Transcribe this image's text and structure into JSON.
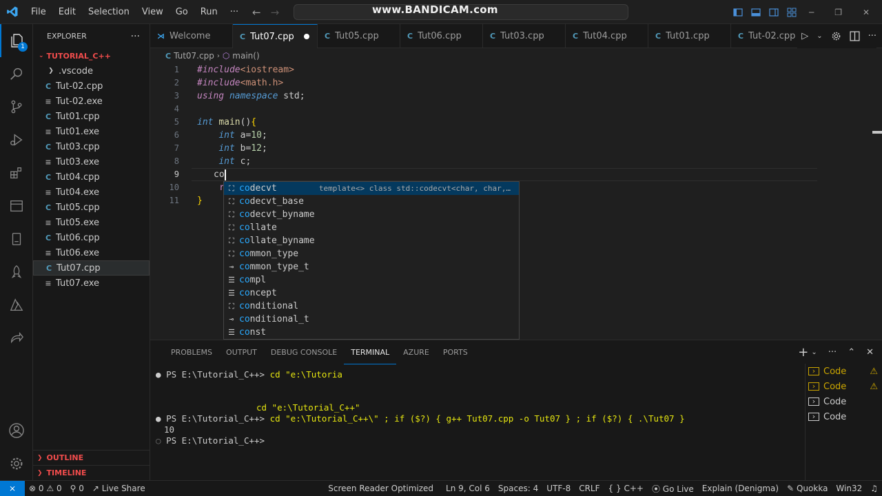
{
  "window": {
    "watermark": "www.BANDICAM.com"
  },
  "menu": [
    "File",
    "Edit",
    "Selection",
    "View",
    "Go",
    "Run",
    "···"
  ],
  "sidebar": {
    "title": "EXPLORER",
    "more": "···",
    "folder": "TUTORIAL_C++",
    "items": [
      {
        "label": ".vscode",
        "type": "dir"
      },
      {
        "label": "Tut-02.cpp",
        "type": "cpp"
      },
      {
        "label": "Tut-02.exe",
        "type": "exe"
      },
      {
        "label": "Tut01.cpp",
        "type": "cpp"
      },
      {
        "label": "Tut01.exe",
        "type": "exe"
      },
      {
        "label": "Tut03.cpp",
        "type": "cpp"
      },
      {
        "label": "Tut03.exe",
        "type": "exe"
      },
      {
        "label": "Tut04.cpp",
        "type": "cpp"
      },
      {
        "label": "Tut04.exe",
        "type": "exe"
      },
      {
        "label": "Tut05.cpp",
        "type": "cpp"
      },
      {
        "label": "Tut05.exe",
        "type": "exe"
      },
      {
        "label": "Tut06.cpp",
        "type": "cpp"
      },
      {
        "label": "Tut06.exe",
        "type": "exe"
      },
      {
        "label": "Tut07.cpp",
        "type": "cpp",
        "selected": true
      },
      {
        "label": "Tut07.exe",
        "type": "exe"
      }
    ],
    "outline": "OUTLINE",
    "timeline": "TIMELINE",
    "badge": "1"
  },
  "tabs": [
    {
      "label": "Welcome",
      "icon": "vscode"
    },
    {
      "label": "Tut07.cpp",
      "icon": "cpp",
      "active": true,
      "modified": true
    },
    {
      "label": "Tut05.cpp",
      "icon": "cpp"
    },
    {
      "label": "Tut06.cpp",
      "icon": "cpp"
    },
    {
      "label": "Tut03.cpp",
      "icon": "cpp"
    },
    {
      "label": "Tut04.cpp",
      "icon": "cpp"
    },
    {
      "label": "Tut01.cpp",
      "icon": "cpp"
    },
    {
      "label": "Tut-02.cpp",
      "icon": "cpp"
    }
  ],
  "breadcrumb": {
    "file": "Tut07.cpp",
    "symbol": "main()"
  },
  "editor": {
    "line_numbers": [
      "1",
      "2",
      "3",
      "4",
      "5",
      "6",
      "7",
      "8",
      "9",
      "10",
      "11"
    ],
    "current_line": 9,
    "cursor_text": "co",
    "hidden_line10_prefix": "r",
    "closing_brace": "}"
  },
  "suggest": {
    "typed": "co",
    "items": [
      {
        "label": "codecvt",
        "kind": "class",
        "detail": "template<> class std::codecvt<char, char,…"
      },
      {
        "label": "codecvt_base",
        "kind": "class"
      },
      {
        "label": "codecvt_byname",
        "kind": "class"
      },
      {
        "label": "collate",
        "kind": "class"
      },
      {
        "label": "collate_byname",
        "kind": "class"
      },
      {
        "label": "common_type",
        "kind": "class"
      },
      {
        "label": "common_type_t",
        "kind": "typedef"
      },
      {
        "label": "compl",
        "kind": "keyword"
      },
      {
        "label": "concept",
        "kind": "keyword"
      },
      {
        "label": "conditional",
        "kind": "class"
      },
      {
        "label": "conditional_t",
        "kind": "typedef"
      },
      {
        "label": "const",
        "kind": "keyword"
      }
    ]
  },
  "panel": {
    "tabs": [
      "PROBLEMS",
      "OUTPUT",
      "DEBUG CONSOLE",
      "TERMINAL",
      "AZURE",
      "PORTS"
    ],
    "active_tab": "TERMINAL",
    "terminal": {
      "line1_prompt": "PS E:\\Tutorial_C++> ",
      "line1_cmd": "cd \"e:\\Tutoria",
      "line2": "cd \"e:\\Tutorial_C++\"",
      "line3_prompt": "PS E:\\Tutorial_C++> ",
      "line3_cmd": "cd \"e:\\Tutorial_C++\\\" ; if ($?) { g++ Tut07.cpp -o Tut07 } ; if ($?) { .\\Tut07 }",
      "line4": "10",
      "line5_prompt": "PS E:\\Tutorial_C++> "
    },
    "term_list": [
      {
        "label": "Code",
        "warn": true
      },
      {
        "label": "Code",
        "warn": true
      },
      {
        "label": "Code",
        "warn": false
      },
      {
        "label": "Code",
        "warn": false
      }
    ]
  },
  "statusbar": {
    "remote": "⨯",
    "errors": "0",
    "warnings": "0",
    "ports": "0",
    "live_share": "Live Share",
    "screen_reader": "Screen Reader Optimized",
    "position": "Ln 9, Col 6",
    "spaces": "Spaces: 4",
    "encoding": "UTF-8",
    "eol": "CRLF",
    "language": "C++",
    "language_icon": "{ }",
    "go_live": "Go Live",
    "explain": "Explain (Denigma)",
    "quokka": "Quokka",
    "platform": "Win32"
  },
  "colors": {
    "accent": "#0078d4",
    "folder_red": "#f14c4c",
    "cpp_icon": "#519aba",
    "warning": "#cca700"
  }
}
